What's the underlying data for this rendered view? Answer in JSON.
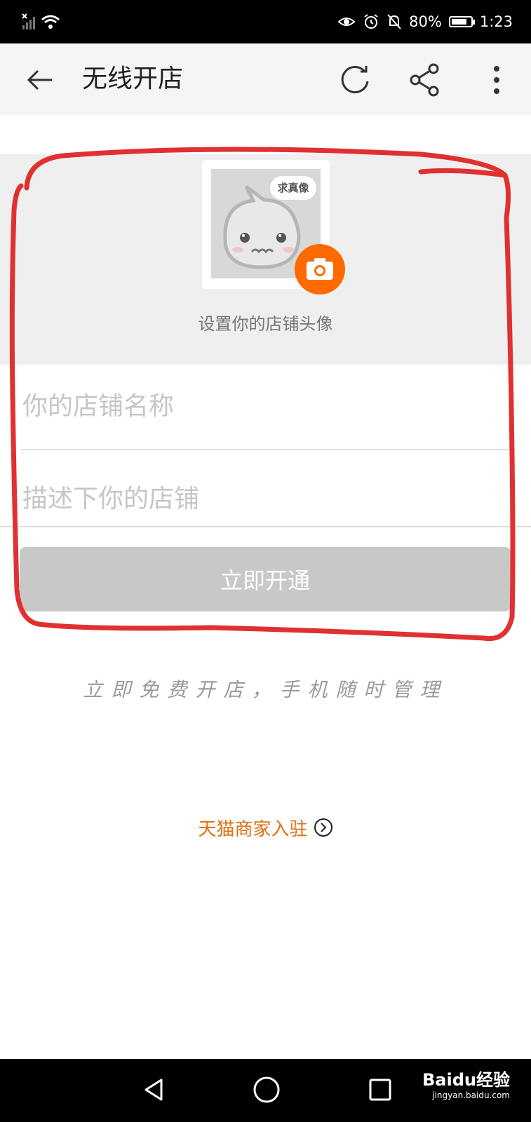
{
  "status_bar": {
    "battery": "80%",
    "battery_level": 0.8,
    "time": "1:23"
  },
  "app_bar": {
    "title": "无线开店",
    "icons": [
      "back-arrow-icon",
      "refresh-icon",
      "share-icon",
      "more-vert-icon"
    ]
  },
  "avatar": {
    "speech_text": "求真像",
    "label": "设置你的店铺头像"
  },
  "form": {
    "name_placeholder": "你的店铺名称",
    "desc_placeholder": "描述下你的店铺",
    "submit_label": "立即开通"
  },
  "tagline": "立即免费开店，手机随时管理",
  "tmall_link": "天猫商家入驻",
  "watermark": {
    "brand": "Baidu经验",
    "url": "jingyan.baidu.com"
  },
  "colors": {
    "accent": "#ff6a00",
    "link": "#e07010",
    "annotation": "#e03030"
  }
}
